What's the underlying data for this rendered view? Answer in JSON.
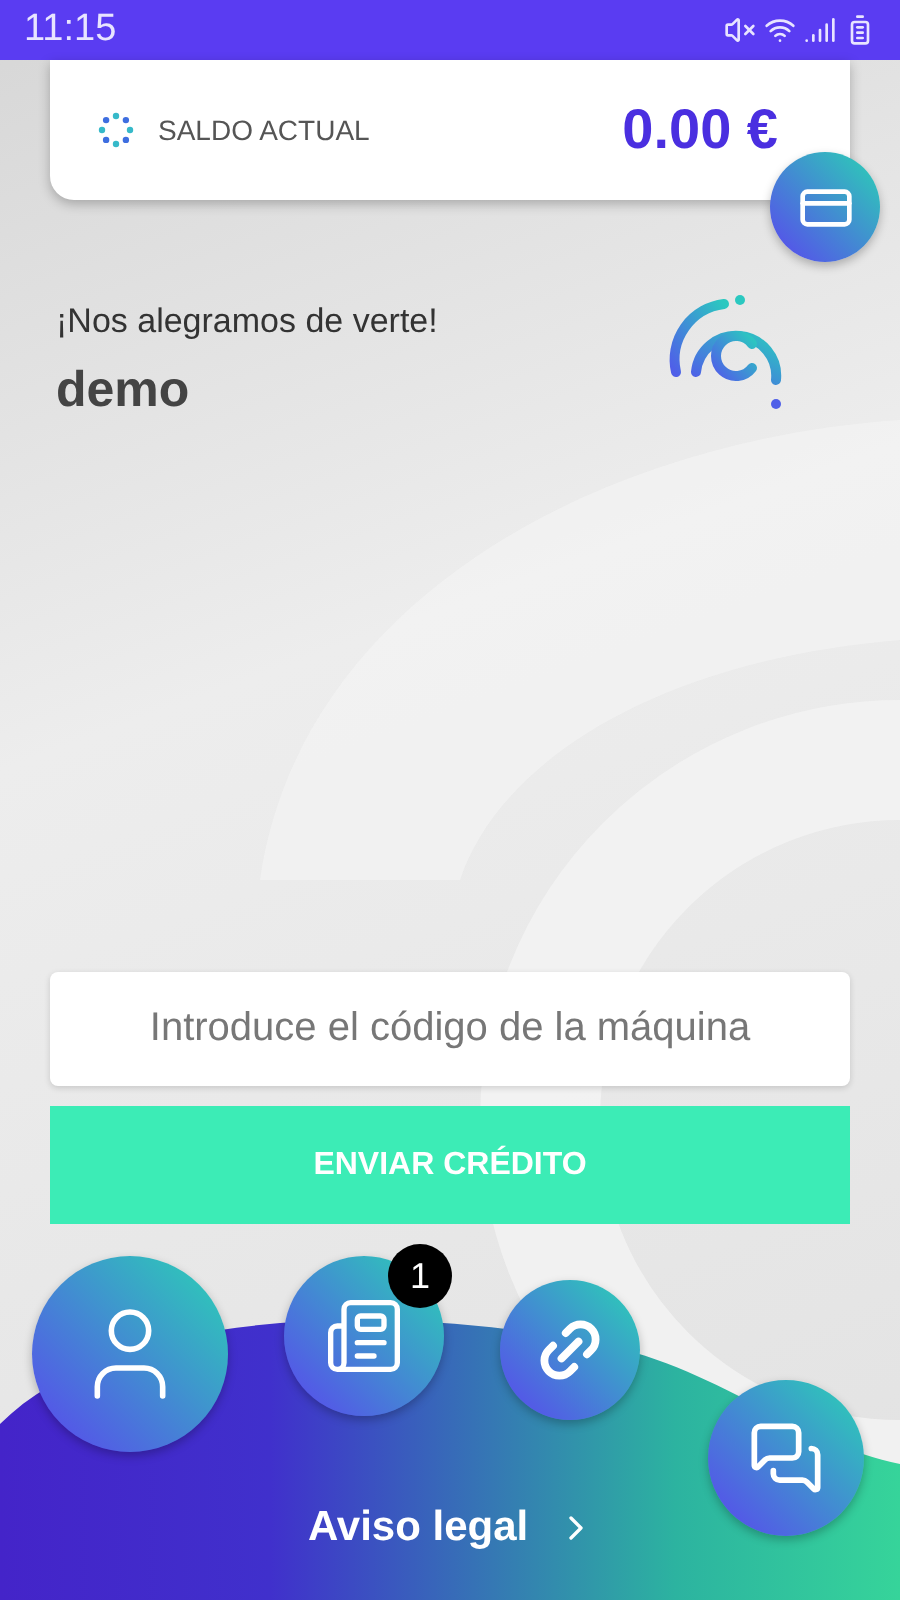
{
  "status_bar": {
    "time": "11:15"
  },
  "balance": {
    "label": "SALDO ACTUAL",
    "amount": "0.00 €"
  },
  "greeting": {
    "message": "¡Nos alegramos de verte!",
    "user": "demo"
  },
  "machine_code": {
    "placeholder": "Introduce el código de la máquina"
  },
  "send_button": {
    "label": "ENVIAR CRÉDITO"
  },
  "nav": [
    {
      "kind": "profile"
    },
    {
      "kind": "news",
      "badge": "1"
    },
    {
      "kind": "link"
    }
  ],
  "chat": {
    "kind": "chat"
  },
  "legal_link": {
    "label": "Aviso legal"
  }
}
